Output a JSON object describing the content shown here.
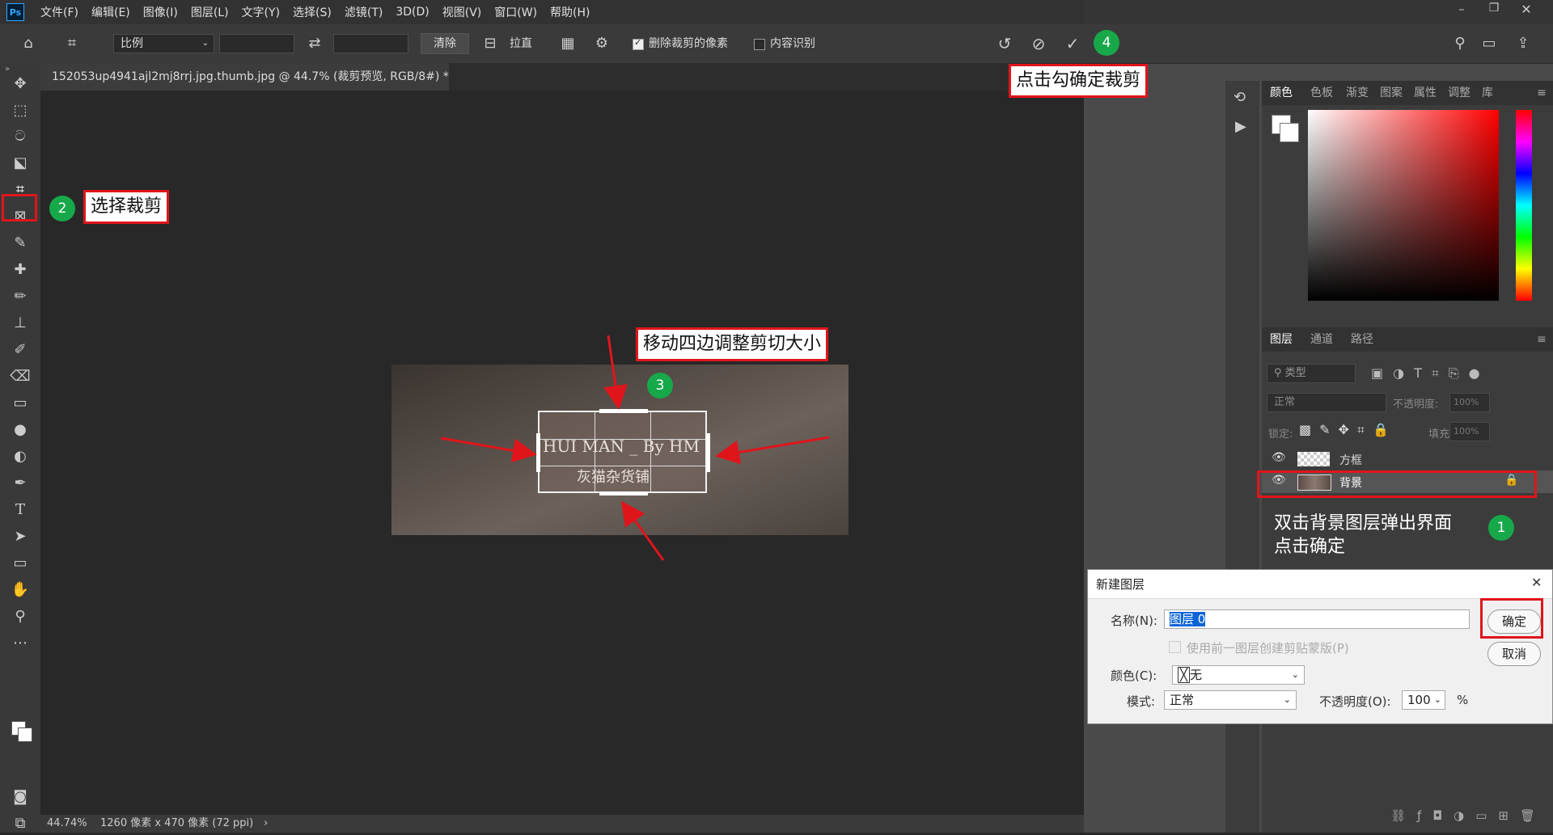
{
  "colors": {
    "accent": "#31a8ff",
    "annotation_red": "#e0151b",
    "step_green": "#17a84a",
    "selection_blue": "#0a64d8"
  },
  "app": {
    "logo": "Ps"
  },
  "menu": [
    "文件(F)",
    "编辑(E)",
    "图像(I)",
    "图层(L)",
    "文字(Y)",
    "选择(S)",
    "滤镜(T)",
    "3D(D)",
    "视图(V)",
    "窗口(W)",
    "帮助(H)"
  ],
  "options": {
    "ratio_select": "比例",
    "clear_button": "清除",
    "straighten_label": "拉直",
    "delete_cropped_label": "删除裁剪的像素",
    "content_aware_label": "内容识别",
    "delete_cropped_checked": true,
    "content_aware_checked": false
  },
  "document": {
    "tab_title": "152053up4941ajl2mj8rrj.jpg.thumb.jpg @ 44.7% (裁剪预览, RGB/8#) *",
    "close_glyph": "×",
    "watermark_line1": "HUI MAN _ By HM",
    "watermark_line2": "灰猫杂货铺"
  },
  "status": {
    "zoom": "44.74%",
    "dimensions": "1260 像素 x 470 像素 (72 ppi)",
    "arrow": "›"
  },
  "color_panel": {
    "tabs": [
      "颜色",
      "色板",
      "渐变",
      "图案",
      "属性",
      "调整",
      "库"
    ],
    "active": "颜色"
  },
  "layers_panel": {
    "tabs": [
      "图层",
      "通道",
      "路径"
    ],
    "active": "图层",
    "filter_placeholder": "类型",
    "blend_mode": "正常",
    "opacity_label": "不透明度:",
    "opacity_value": "100%",
    "lock_label": "锁定:",
    "fill_label": "填充:",
    "fill_value": "100%",
    "layers": [
      {
        "name": "方框",
        "selected": false
      },
      {
        "name": "背景",
        "selected": true
      }
    ]
  },
  "annotations": {
    "step1_text_line1": "双击背景图层弹出界面",
    "step1_text_line2": "点击确定",
    "step1_num": "1",
    "step2_text": "选择裁剪",
    "step2_num": "2",
    "step3_text": "移动四边调整剪切大小",
    "step3_num": "3",
    "step4_text": "点击勾确定裁剪",
    "step4_num": "4"
  },
  "dialog": {
    "title": "新建图层",
    "name_label": "名称(N):",
    "name_value": "图层 0",
    "clip_label": "使用前一图层创建剪贴蒙版(P)",
    "color_label": "颜色(C):",
    "color_value": "无",
    "mode_label": "模式:",
    "mode_value": "正常",
    "opacity_label": "不透明度(O):",
    "opacity_value": "100",
    "percent": "%",
    "ok_label": "确定",
    "cancel_label": "取消"
  }
}
